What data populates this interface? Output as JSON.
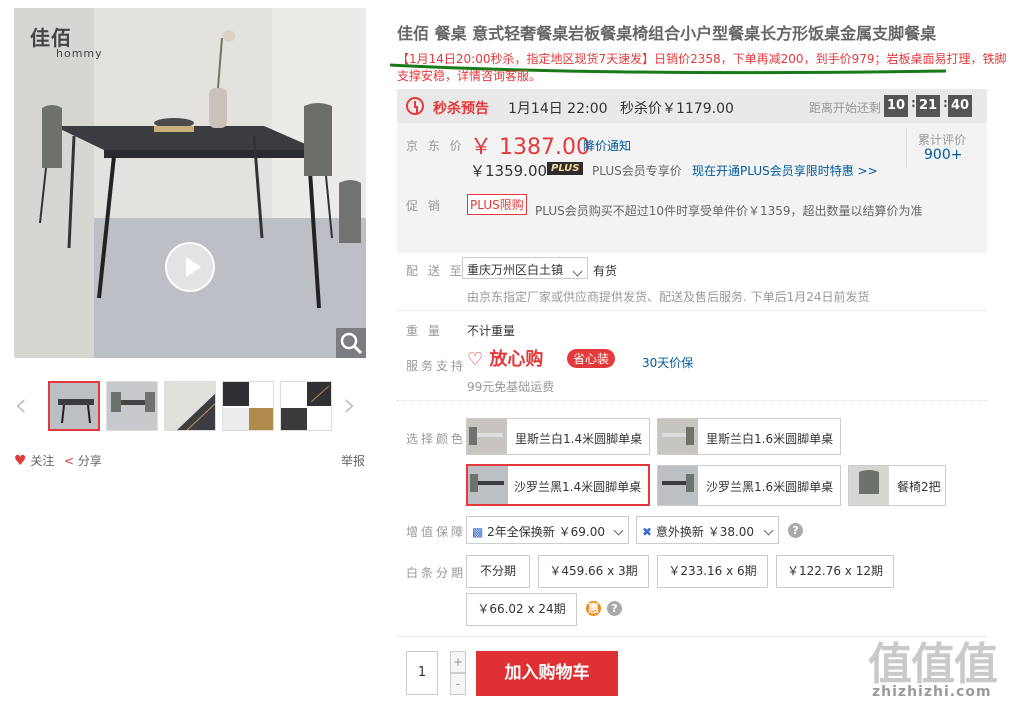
{
  "brand": {
    "cn": "佳佰",
    "en": "hommy"
  },
  "gallery": {
    "actions": {
      "follow": "关注",
      "share": "分享",
      "report": "举报"
    }
  },
  "product": {
    "title": "佳佰 餐桌 意式轻奢餐桌岩板餐桌椅组合小户型餐桌长方形饭桌金属支脚餐桌",
    "promo_text": "【1月14日20:00秒杀，指定地区现货7天速发】日销价2358，下单再减200，到手价979；岩板桌面易打理，铁脚支撑安稳，详情咨询客服。"
  },
  "seckill": {
    "label": "秒杀预告",
    "time": "1月14日 22:00",
    "price_text": "秒杀价￥1179.00",
    "countdown_label": "距离开始还剩",
    "countdown": [
      "10",
      "21",
      "40"
    ]
  },
  "price": {
    "label": "京 东 价",
    "jd_price": "￥ 1387.00",
    "notice": "降价通知",
    "plus_price": "￥1359.00",
    "plus_badge": "PLUS",
    "plus_text": "PLUS会员专享价",
    "plus_link": "现在开通PLUS会员享限时特惠 >>",
    "review_label": "累计评价",
    "review_count": "900+"
  },
  "promotion": {
    "label": "促  销",
    "tag": "PLUS限购",
    "text": "PLUS会员购买不超过10件时享受单件价￥1359，超出数量以结算价为准"
  },
  "delivery": {
    "label": "配 送 至",
    "location": "重庆万州区白土镇",
    "stock": "有货",
    "note": "由京东指定厂家或供应商提供发货、配送及售后服务. 下单后1月24日前发货"
  },
  "weight": {
    "label": "重  量",
    "value": "不计重量"
  },
  "service": {
    "label": "服务支持",
    "brand": "放心购",
    "pill": "省心装",
    "warranty": "30天价保",
    "freight": "99元免基础运费"
  },
  "colors": {
    "label": "选择颜色",
    "options": [
      "里斯兰白1.4米圆脚单桌",
      "里斯兰白1.6米圆脚单桌",
      "沙罗兰黑1.4米圆脚单桌",
      "沙罗兰黑1.6米圆脚单桌",
      "餐椅2把"
    ],
    "selected_index": 2
  },
  "protection": {
    "label": "增值保障",
    "options": [
      "2年全保换新 ￥69.00",
      "意外换新 ￥38.00"
    ]
  },
  "installment": {
    "label": "白条分期",
    "options": [
      "不分期",
      "￥459.66 x 3期",
      "￥233.16 x 6期",
      "￥122.76 x 12期",
      "￥66.02 x 24期"
    ]
  },
  "cart": {
    "quantity": "1",
    "plus": "+",
    "minus": "-",
    "button": "加入购物车"
  },
  "watermark": {
    "text": "值值值",
    "url": "zhizhizhi.com"
  },
  "colors_theme": {
    "accent": "#e4393c",
    "link": "#005aa0",
    "underline": "#1a7a1a"
  }
}
